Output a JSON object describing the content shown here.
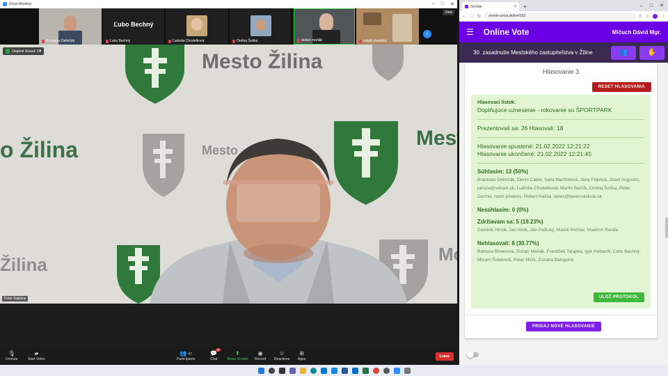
{
  "zoom": {
    "window_title": "Zoom Meeting",
    "view_label": "View",
    "orig_sound": "Original Sound: Off",
    "participants_strip": [
      {
        "name": "Branislav Delinčák"
      },
      {
        "name": "Ľubo Bechný",
        "display": "Ľubo Bechný"
      },
      {
        "name": "Ľudmila Chodelková"
      },
      {
        "name": "Ondrej Šoška"
      },
      {
        "name": "dušan maňák"
      },
      {
        "name": "rudolf chodelka"
      }
    ],
    "active_speaker": "Peter Fiabáne",
    "toolbar": {
      "unmute": "Unmute",
      "start_video": "Start Video",
      "participants": "Participants",
      "participants_count": "47",
      "chat": "Chat",
      "chat_badge": "5",
      "share": "Share Screen",
      "record": "Record",
      "reactions": "Reactions",
      "apps": "Apps",
      "leave": "Leave"
    }
  },
  "browser": {
    "tab_title": "OnVote",
    "url": "onvote.uniza.sk/live/162"
  },
  "app": {
    "title": "Online Vote",
    "user": "Mičuch Dávid Mgr.",
    "session": "30. zasadnutie Mestského zastupiteľstva v Žiline",
    "vote_heading": "Hlasovanie 3",
    "reset_button": "RESET HLASOVANIA",
    "ballot": {
      "label": "Hlasovací lístok:",
      "subject": "Doplňujúce uznesenie - rokovanie so ŠPORTPARK",
      "presence": "Prezentovali sa: 26 Hlasovali: 18",
      "started": "Hlasovanie spustené: 21.02.2022 12:21:22",
      "ended": "Hlasovanie ukončené: 21.02.2022 12:21:45",
      "yes_head": "Súhlasím: 13 (50%)",
      "yes_names": "Branislav Delinčák, Denis Cader, Iveta Martinková, Jana Filipová, Jozef Augustín, jurisza@vekam.sk, Ľudmila Chodelková, Martin Barčík, Ondrej Šoška, Peter Durmis, rasto johanes, Robert Kašša, tanec@tanecnaskola.sk",
      "no_head": "Nesúhlasím: 0 (0%)",
      "abstain_head": "Zdržiavam sa: 5 (19.23%)",
      "abstain_names": "Dominik Hrinik, Jan Nicik, Ján Pažický, Marek Richter, Vladimír Randa",
      "notvoted_head": "Nehlasovali: 8 (30.77%)",
      "notvoted_names": "Barbora Bimerová, Dušan Maňák, František Talapka, Igor Habaník, Ľubo Bechný, Miriam Šuteková, Peter Ničík, Zuzana Balogová",
      "save_button": "ULOŽ PROTOKOL"
    },
    "add_vote_button": "PRIDAJ NOVÉ HLASOVANIE"
  },
  "colors": {
    "brand_purple": "#6b00e6",
    "session_bar": "#3a2a52",
    "reset_red": "#b71c1c",
    "ballot_green_bg": "#e2f5d2",
    "ballot_green_text": "#2e6b22",
    "save_green": "#3fb93a"
  }
}
